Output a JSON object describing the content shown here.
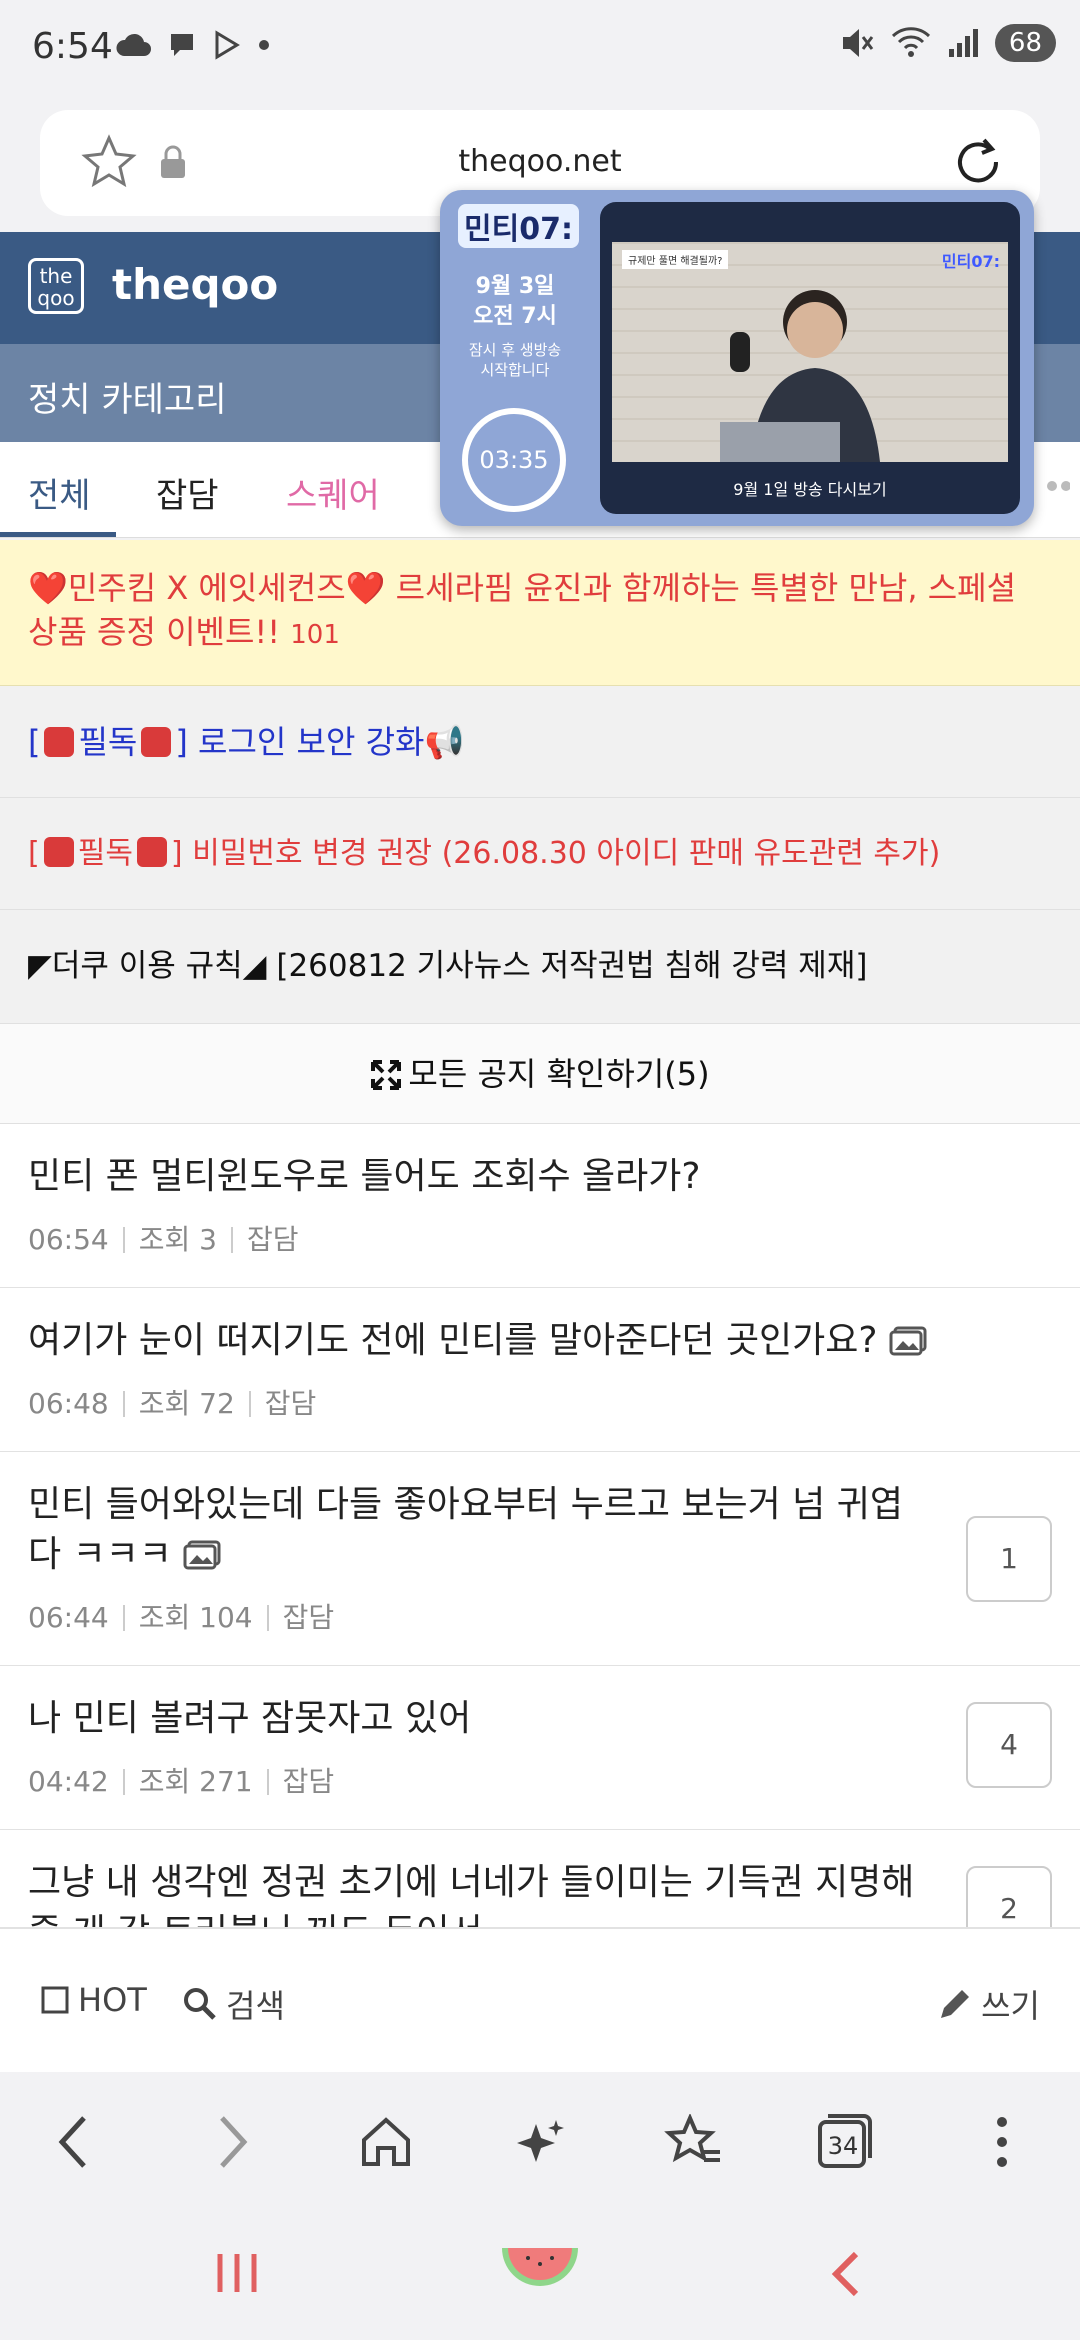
{
  "status": {
    "time": "6:54",
    "battery": "68",
    "wifi_label": "5"
  },
  "url_bar": {
    "url": "theqoo.net"
  },
  "site": {
    "logo_text": "the qoo",
    "name": "theqoo",
    "category": "정치 카테고리"
  },
  "tabs": [
    {
      "label": "전체"
    },
    {
      "label": "잡담"
    },
    {
      "label": "스퀘어"
    }
  ],
  "video": {
    "logo": "민티07:",
    "date_line1": "9월 3일",
    "date_line2": "오전 7시",
    "sub_line1": "잠시 후 생방송",
    "sub_line2": "시작합니다",
    "timer": "03:35",
    "badge": "규제만 풀면 해결될까?",
    "screen_logo": "민티07:",
    "caption": "9월 1일 방송 다시보기"
  },
  "notices": {
    "event": "❤️민주킴 X 에잇세컨즈❤️ 르세라핌 윤진과 함께하는 특별한 만남, 스페셜 상품 증정 이벤트!!",
    "event_count": "101",
    "n1_prefix": "[",
    "n1_tag": "필독",
    "n1_text": "] 로그인 보안 강화📢",
    "n2_prefix": "[",
    "n2_tag": "필독",
    "n2_text": "] 비밀번호 변경 권장 (26.08.30 아이디 판매 유도관련 추가)",
    "n3": "◤더쿠 이용 규칙◢ [260812 기사뉴스 저작권법 침해 강력 제재]",
    "all": "모든 공지 확인하기(5)"
  },
  "posts": [
    {
      "title": "민티 폰 멀티윈도우로 틀어도 조회수 올라가?",
      "time": "06:54",
      "views": "조회 3",
      "cat": "잡담"
    },
    {
      "title": "여기가 눈이 떠지기도 전에 민티를 말아준다던 곳인가요?",
      "time": "06:48",
      "views": "조회 72",
      "cat": "잡담"
    },
    {
      "title": "민티 들어와있는데 다들 좋아요부터 누르고 보는거 넘 귀엽다 ㅋㅋㅋ",
      "time": "06:44",
      "views": "조회 104",
      "cat": "잡담",
      "comments": "1"
    },
    {
      "title": "나 민티 볼려구 잠못자고 있어",
      "time": "04:42",
      "views": "조회 271",
      "cat": "잡담",
      "comments": "4"
    },
    {
      "title": "그냥 내 생각엔 정권 초기에 너네가 들이미는 기득권 지명해줄 게 각 트러블나 꺼도 두어서",
      "comments": "2"
    }
  ],
  "toolbar": {
    "hot": "HOT",
    "search": "검색",
    "write": "쓰기"
  },
  "browser": {
    "tab_count": "34"
  }
}
